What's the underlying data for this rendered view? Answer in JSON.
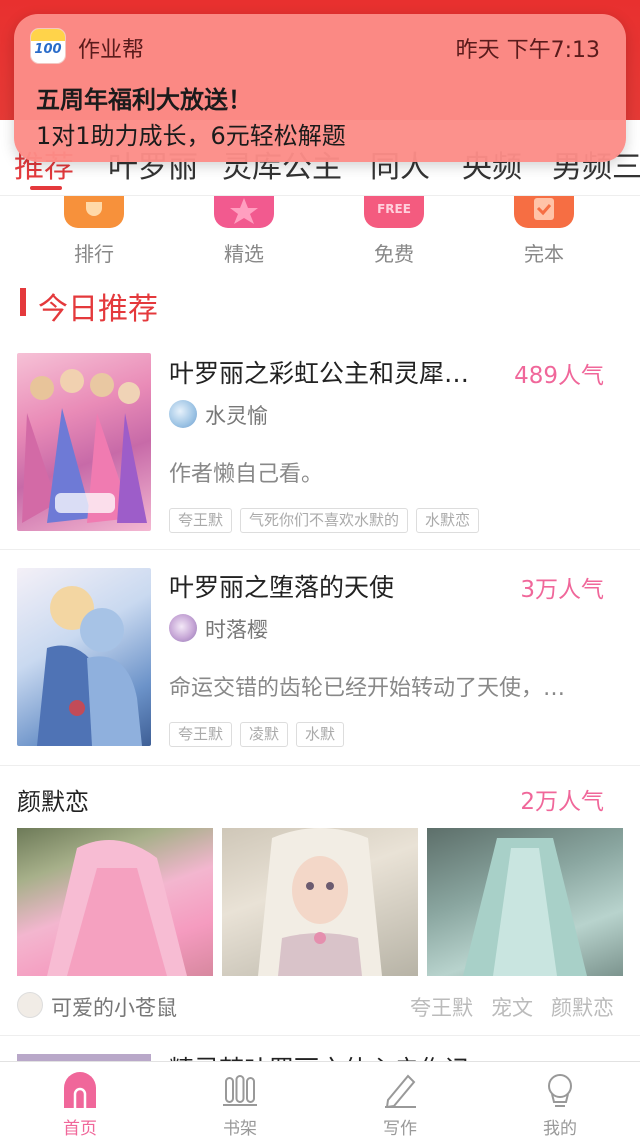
{
  "notification": {
    "app_name": "作业帮",
    "app_icon_text": "100",
    "time": "昨天 下午7:13",
    "title": "五周年福利大放送！",
    "body": "1对1助力成长，6元轻松解题"
  },
  "tabs": [
    "推荐",
    "叶罗丽",
    "灵库公主",
    "同人",
    "央频",
    "男频三"
  ],
  "quick_entries": [
    {
      "label": "排行",
      "color": "#f7913b"
    },
    {
      "label": "精选",
      "color": "#f25a8f"
    },
    {
      "label": "免费",
      "color": "#f45b7f",
      "badge": "FREE"
    },
    {
      "label": "完本",
      "color": "#f66e43"
    }
  ],
  "section": {
    "title": "今日推荐"
  },
  "books": [
    {
      "title": "叶罗丽之彩虹公主和灵犀…",
      "popularity": "489人气",
      "author": "水灵愉",
      "description": "作者懒自己看。",
      "tags": [
        "夸王默",
        "气死你们不喜欢水默的",
        "水默恋"
      ]
    },
    {
      "title": "叶罗丽之堕落的天使",
      "popularity": "3万人气",
      "author": "时落樱",
      "description": "命运交错的齿轮已经开始转动了天使，…",
      "tags": [
        "夸王默",
        "凌默",
        "水默"
      ]
    }
  ],
  "post": {
    "title": "颜默恋",
    "popularity": "2万人气",
    "user": "可爱的小苍鼠",
    "tags": [
      "夸王默",
      "宠文",
      "颜默恋"
    ]
  },
  "peek_text": "精灵梦叶罗丽之仙心启作记",
  "bottom_nav": [
    {
      "label": "首页",
      "icon": "home-icon",
      "active": true
    },
    {
      "label": "书架",
      "icon": "bookshelf-icon",
      "active": false
    },
    {
      "label": "写作",
      "icon": "pen-icon",
      "active": false
    },
    {
      "label": "我的",
      "icon": "profile-icon",
      "active": false
    }
  ],
  "colors": {
    "brand_red": "#e4393c",
    "popularity_pink": "#f0679a",
    "notification_bg": "#fc8c87"
  }
}
